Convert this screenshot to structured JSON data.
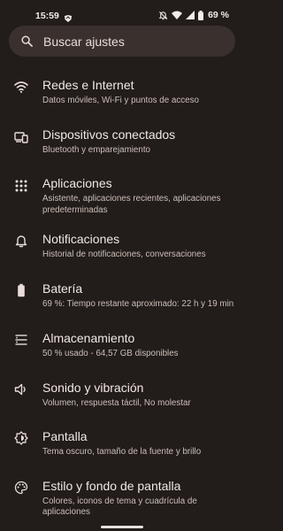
{
  "status_bar": {
    "time": "15:59",
    "battery_text": "69 %"
  },
  "search": {
    "placeholder": "Buscar ajustes"
  },
  "settings": [
    {
      "title": "Redes e Internet",
      "subtitle": "Datos móviles, Wi-Fi y puntos de acceso",
      "icon": "wifi-icon"
    },
    {
      "title": "Dispositivos conectados",
      "subtitle": "Bluetooth y emparejamiento",
      "icon": "devices-icon"
    },
    {
      "title": "Aplicaciones",
      "subtitle": "Asistente, aplicaciones recientes, aplicaciones predeterminadas",
      "icon": "apps-grid-icon"
    },
    {
      "title": "Notificaciones",
      "subtitle": "Historial de notificaciones, conversaciones",
      "icon": "bell-icon"
    },
    {
      "title": "Batería",
      "subtitle": "69 %: Tiempo restante aproximado: 22 h y 19 min",
      "icon": "battery-icon"
    },
    {
      "title": "Almacenamiento",
      "subtitle": "50 % usado - 64,57 GB disponibles",
      "icon": "storage-icon"
    },
    {
      "title": "Sonido y vibración",
      "subtitle": "Volumen, respuesta táctil, No molestar",
      "icon": "volume-icon"
    },
    {
      "title": "Pantalla",
      "subtitle": "Tema oscuro, tamaño de la fuente y brillo",
      "icon": "brightness-icon"
    },
    {
      "title": "Estilo y fondo de pantalla",
      "subtitle": "Colores, iconos de tema y cuadrícula de aplicaciones",
      "icon": "palette-icon"
    }
  ],
  "colors": {
    "background": "#221c1a",
    "search_bg": "#3a302d",
    "text_primary": "#f2e8e4",
    "text_secondary": "#cdbfba"
  }
}
